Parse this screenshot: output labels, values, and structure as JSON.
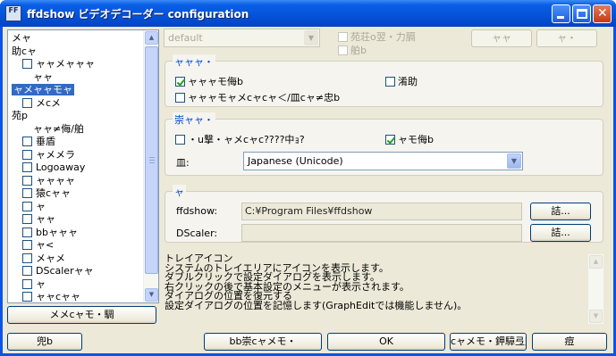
{
  "window": {
    "title": "ffdshow ビデオデコーダー configuration",
    "icon_text": "FF"
  },
  "tree": {
    "items": [
      {
        "label": "メャ",
        "checkbox": false,
        "selected": false,
        "indent": 0
      },
      {
        "label": "助cャ",
        "checkbox": false,
        "selected": false,
        "indent": 0
      },
      {
        "label": "ャャメャャャ",
        "checkbox": true,
        "selected": false,
        "indent": 1
      },
      {
        "label": "ャャ",
        "checkbox": false,
        "selected": false,
        "indent": 2
      },
      {
        "label": "ャメャャモャ",
        "checkbox": false,
        "selected": true,
        "indent": 0
      },
      {
        "label": "メcメ",
        "checkbox": true,
        "selected": false,
        "indent": 1
      },
      {
        "label": "苑p",
        "checkbox": false,
        "selected": false,
        "indent": 0
      },
      {
        "label": "ャャ≠侮/舶",
        "checkbox": false,
        "selected": false,
        "indent": 2
      },
      {
        "label": "垂盾",
        "checkbox": true,
        "selected": false,
        "indent": 1
      },
      {
        "label": "ャメメラ",
        "checkbox": true,
        "selected": false,
        "indent": 1
      },
      {
        "label": "Logoaway",
        "checkbox": true,
        "selected": false,
        "indent": 1
      },
      {
        "label": "ャャャャ",
        "checkbox": true,
        "selected": false,
        "indent": 1
      },
      {
        "label": "猿cャャ",
        "checkbox": true,
        "selected": false,
        "indent": 1
      },
      {
        "label": "ャ",
        "checkbox": true,
        "selected": false,
        "indent": 1
      },
      {
        "label": "ャャ",
        "checkbox": true,
        "selected": false,
        "indent": 1
      },
      {
        "label": "bbャャャ",
        "checkbox": true,
        "selected": false,
        "indent": 1
      },
      {
        "label": "ャ<",
        "checkbox": true,
        "selected": false,
        "indent": 1
      },
      {
        "label": "メャメ",
        "checkbox": true,
        "selected": false,
        "indent": 1
      },
      {
        "label": "DScalerャャ",
        "checkbox": true,
        "selected": false,
        "indent": 1
      },
      {
        "label": "ャ",
        "checkbox": true,
        "selected": false,
        "indent": 1
      },
      {
        "label": "ャャcャャ",
        "checkbox": true,
        "selected": false,
        "indent": 1
      }
    ],
    "bottom_button": "メメcャモ・騆"
  },
  "top": {
    "preset_combo": "default",
    "check1": "苑荘o翌・力膈",
    "check2": "舶b",
    "btn1": "ャャ",
    "btn2": "ャ・"
  },
  "group1": {
    "title": "ャャャ・",
    "check_a": {
      "label": "ャャャモ侮b",
      "checked": true
    },
    "check_b": {
      "label": "淆助",
      "checked": false
    },
    "check_c": {
      "label": "ャャャモャメcャcャ＜/皿cャ≠忠b",
      "checked": false
    }
  },
  "group2": {
    "title": "崇ャャ・",
    "check_a": {
      "label": "・u撃・ャメcャc????中ｮ?",
      "checked": false
    },
    "check_b": {
      "label": "ャモ侮b",
      "checked": true
    },
    "lang_label": "皿:",
    "lang_value": "Japanese (Unicode)"
  },
  "group3": {
    "title": "ャ",
    "ffdshow_label": "ffdshow:",
    "ffdshow_path": "C:¥Program Files¥ffdshow",
    "ffdshow_button": "詰...",
    "dscaler_label": "DScaler:",
    "dscaler_path": "",
    "dscaler_button": "詰..."
  },
  "info": {
    "lines": [
      "トレイアイコン",
      "  システムのトレイエリアにアイコンを表示します。",
      "  ダブルクリックで設定ダイアログを表示します。",
      "  右クリックの後で基本設定のメニューが表示されます。",
      "ダイアログの位置を復元する",
      "  設定ダイアログの位置を記憶します(GraphEditでは機能しません)。"
    ]
  },
  "bottom": {
    "left_button": "兜b",
    "btn_reset": "bb崇cャメモ・",
    "ok": "OK",
    "btn_apply": "cャメモ・鉀騿弖賄",
    "cancel": "痘"
  }
}
